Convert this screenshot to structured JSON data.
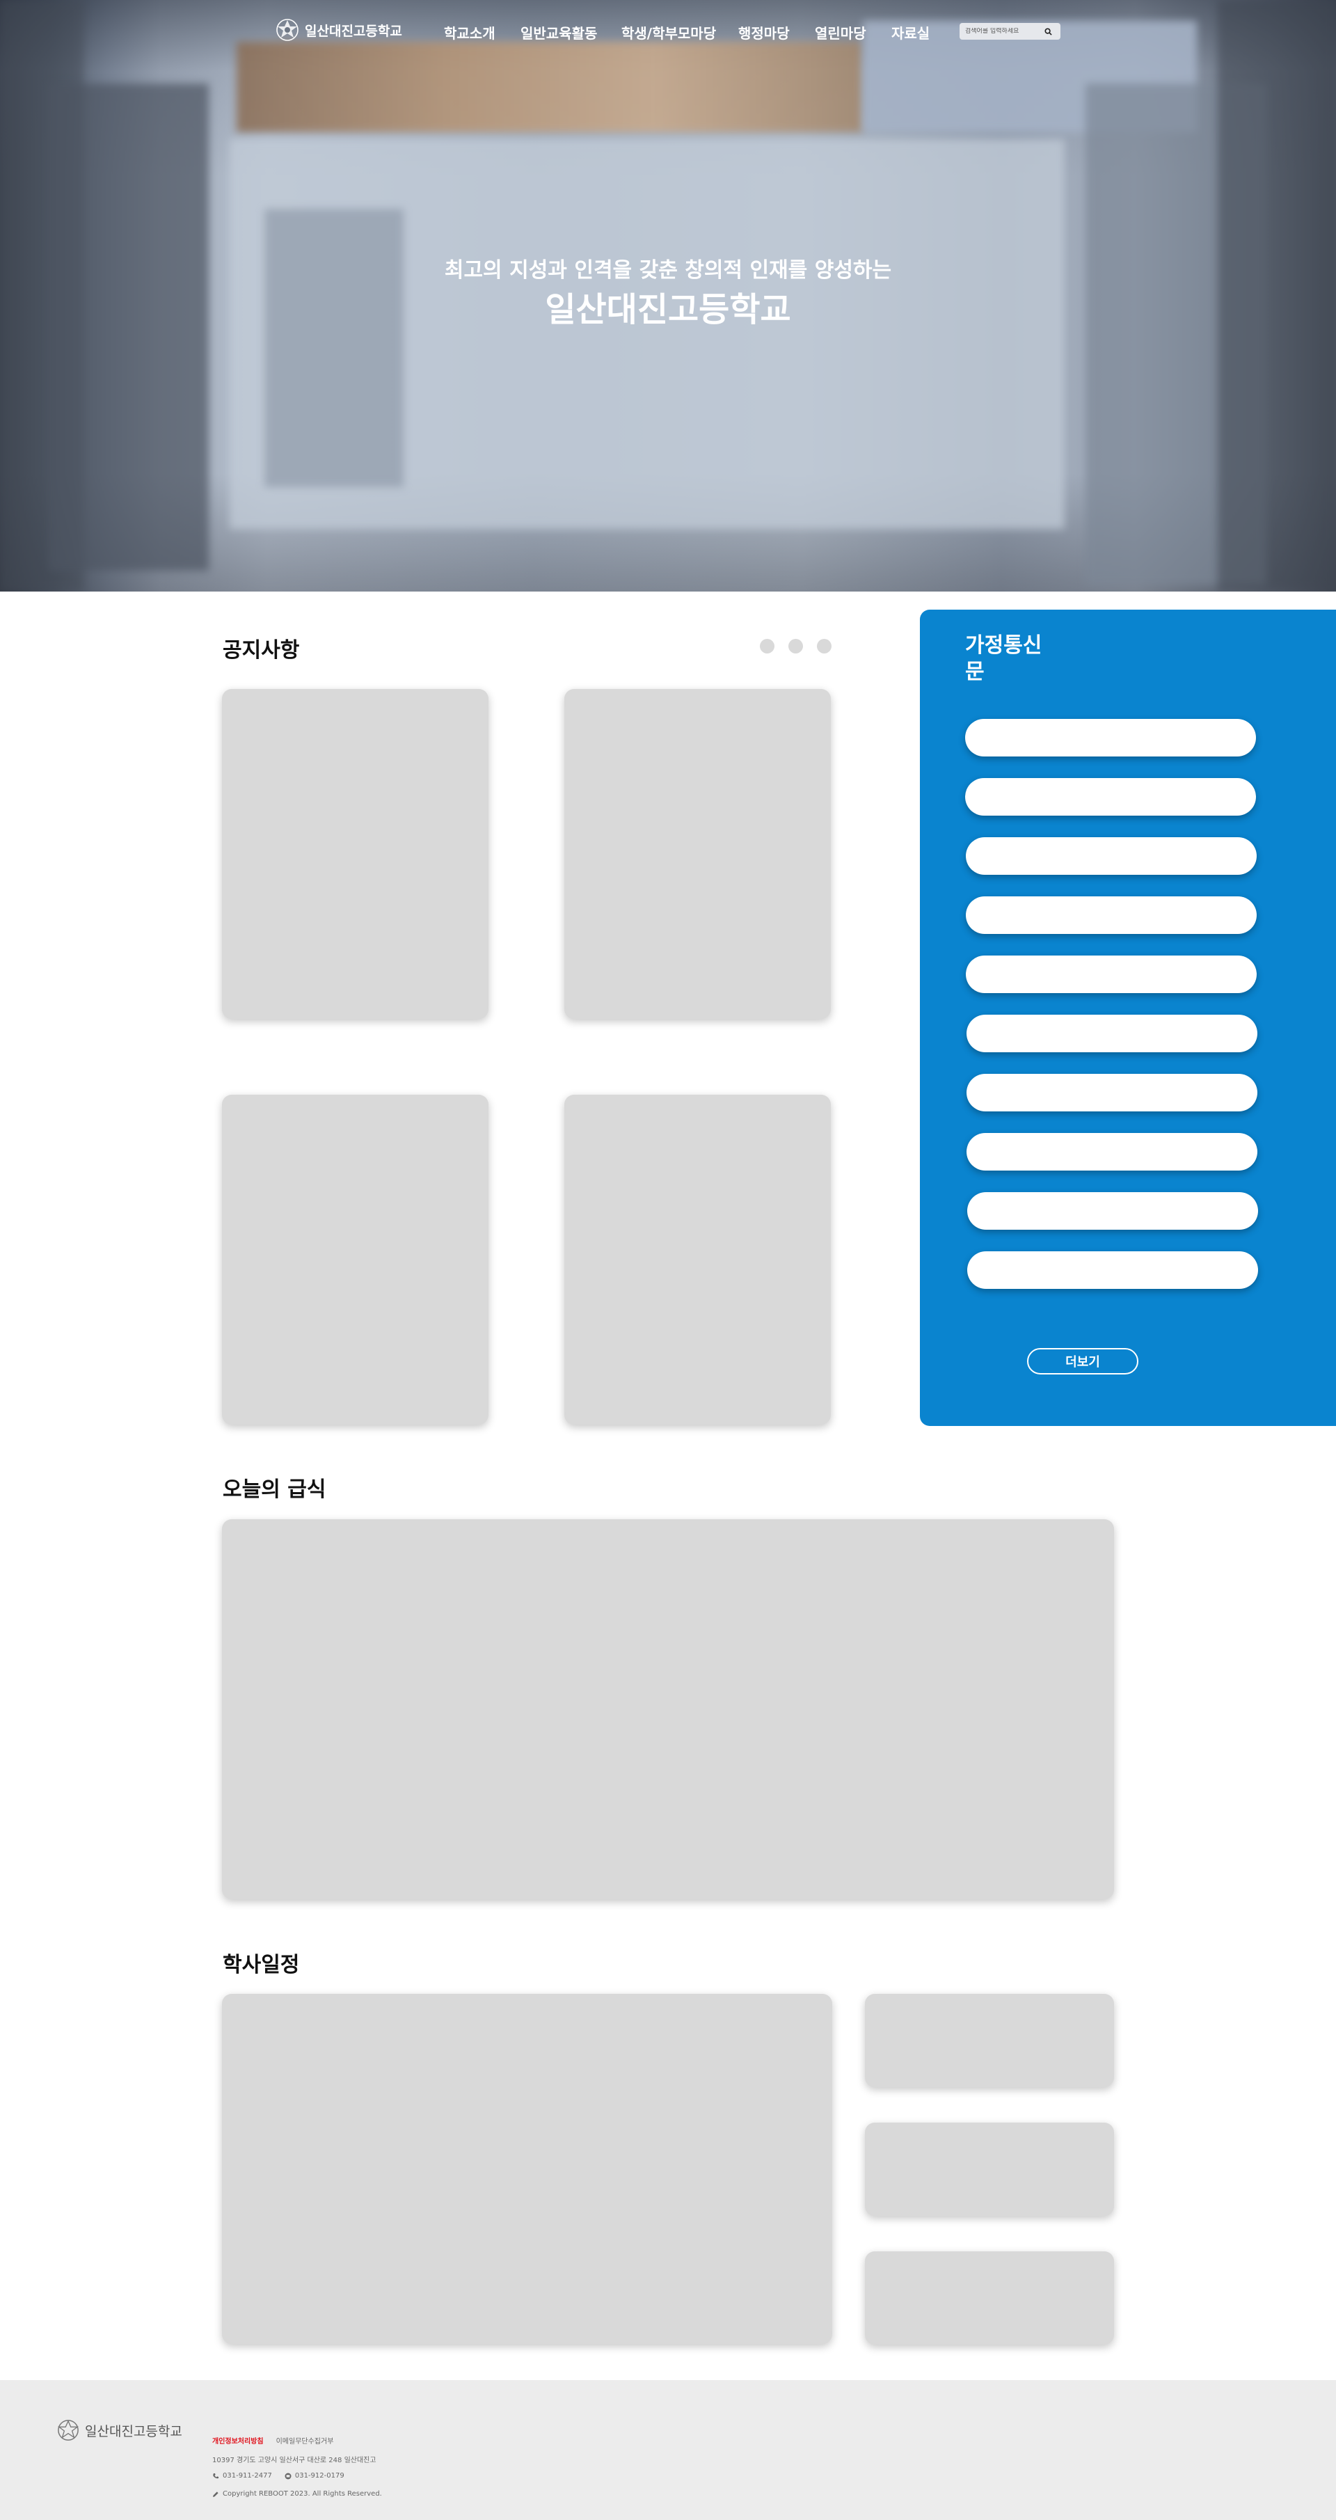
{
  "school": {
    "name": "일산대진고등학교"
  },
  "nav": {
    "items": [
      "학교소개",
      "일반교육활동",
      "학생/학부모마당",
      "행정마당",
      "열린마당",
      "자료실"
    ],
    "search_placeholder": "검색어를 입력하세요"
  },
  "hero": {
    "subtitle": "최고의 지성과 인격을 갖춘 창의적 인재를 양성하는",
    "title": "일산대진고등학교"
  },
  "notice": {
    "title": "공지사항",
    "slider_dots": 3
  },
  "newsletter": {
    "title": "가정통신문",
    "item_count": 10,
    "more_label": "더보기"
  },
  "meal": {
    "title": "오늘의 급식"
  },
  "schedule": {
    "title": "학사일정"
  },
  "footer": {
    "logo_text": "일산대진고등학교",
    "privacy_label": "개인정보처리방침",
    "email_policy_label": "이메일무단수집거부",
    "address": "10397 경기도 고양시 일산서구 대산로 248 일산대진고",
    "phone": "031-911-2477",
    "fax": "031-912-0179",
    "copyright": "Copyright REBOOT 2023. All Rights Reserved."
  },
  "colors": {
    "panel_blue": "#0A84CF",
    "card_gray": "#D9D9D9",
    "footer_bg": "#ECECEC",
    "privacy_red": "#E0141E"
  }
}
